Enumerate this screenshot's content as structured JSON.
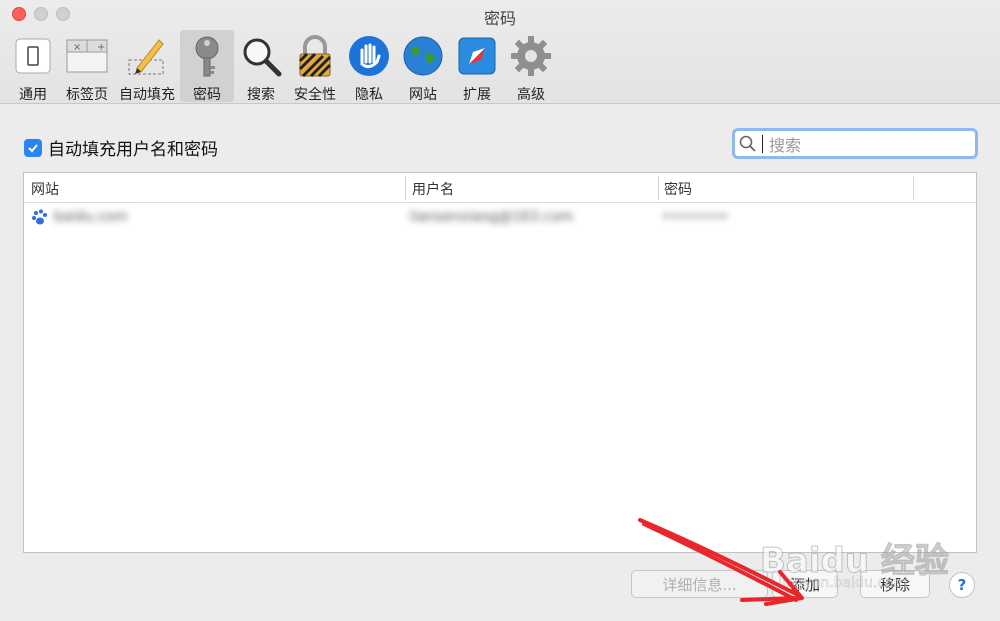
{
  "window": {
    "title": "密码"
  },
  "toolbar": {
    "items": [
      {
        "label": "通用",
        "icon": "general-icon"
      },
      {
        "label": "标签页",
        "icon": "tabs-icon"
      },
      {
        "label": "自动填充",
        "icon": "autofill-pencil-icon"
      },
      {
        "label": "密码",
        "icon": "key-icon",
        "active": true
      },
      {
        "label": "搜索",
        "icon": "magnifier-icon"
      },
      {
        "label": "安全性",
        "icon": "padlock-icon"
      },
      {
        "label": "隐私",
        "icon": "hand-icon"
      },
      {
        "label": "网站",
        "icon": "globe-icon"
      },
      {
        "label": "扩展",
        "icon": "puzzle-compass-icon"
      },
      {
        "label": "高级",
        "icon": "gear-icon"
      }
    ]
  },
  "autofill": {
    "label": "自动填充用户名和密码",
    "checked": true
  },
  "search": {
    "placeholder": "搜索"
  },
  "table": {
    "columns": [
      "网站",
      "用户名",
      "密码"
    ],
    "rows": [
      {
        "site": "baidu.com",
        "user": "liansenxiaog@163.com",
        "password": "••••••••"
      }
    ]
  },
  "buttons": {
    "details": "详细信息...",
    "add": "添加",
    "remove": "移除",
    "help": "?"
  },
  "watermark": {
    "text": "Baidu 经验",
    "url": "jingyan.baidu.com"
  },
  "colors": {
    "accent": "#2b84f3",
    "close": "#fc605b",
    "annotation": "#e8262b"
  }
}
